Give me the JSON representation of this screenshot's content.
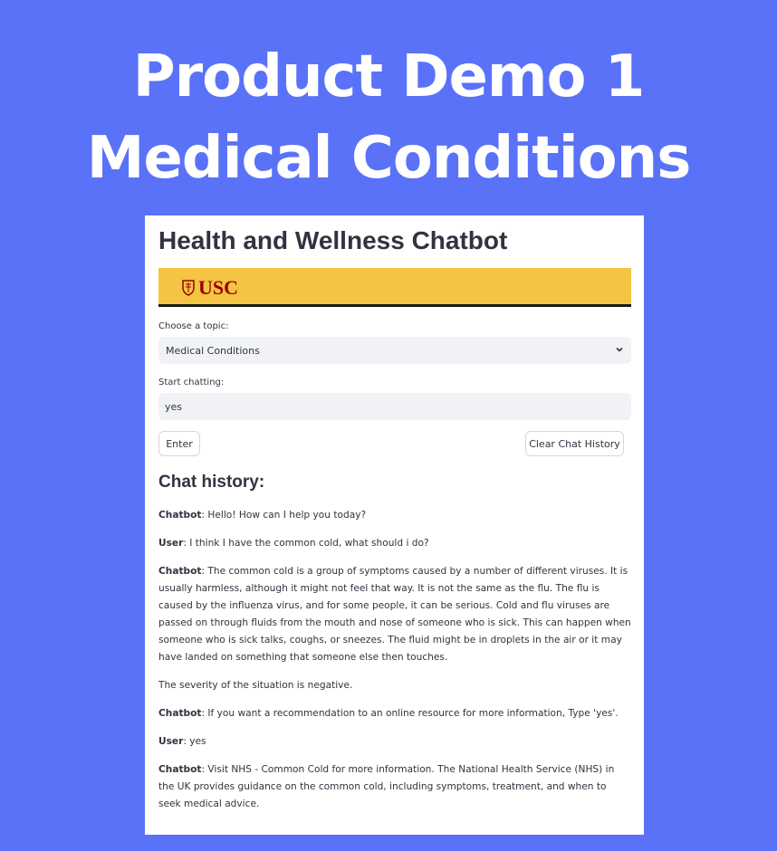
{
  "banner": {
    "line1": "Product Demo 1",
    "line2": "Medical Conditions"
  },
  "app": {
    "title": "Health and Wellness Chatbot",
    "logo_text": "USC",
    "logo_icon": "usc-shield-icon"
  },
  "topic": {
    "label": "Choose a topic:",
    "selected": "Medical Conditions",
    "icon": "chevron-down-icon"
  },
  "chat_input": {
    "label": "Start chatting:",
    "value": "yes"
  },
  "buttons": {
    "enter": "Enter",
    "clear": "Clear Chat History"
  },
  "history": {
    "title": "Chat history:",
    "messages": [
      {
        "speaker": "Chatbot",
        "text": ": Hello! How can I help you today?"
      },
      {
        "speaker": "User",
        "text": ": I think I have the common cold, what should i do?"
      },
      {
        "speaker": "Chatbot",
        "text": ": The common cold is a group of symptoms caused by a number of different viruses. It is usually harmless, although it might not feel that way. It is not the same as the flu. The flu is caused by the influenza virus, and for some people, it can be serious. Cold and flu viruses are passed on through fluids from the mouth and nose of someone who is sick. This can happen when someone who is sick talks, coughs, or sneezes. The fluid might be in droplets in the air or it may have landed on something that someone else then touches."
      },
      {
        "speaker": "",
        "text": "The severity of the situation is negative."
      },
      {
        "speaker": "Chatbot",
        "text": ": If you want a recommendation to an online resource for more information, Type 'yes'."
      },
      {
        "speaker": "User",
        "text": ": yes"
      },
      {
        "speaker": "Chatbot",
        "text": ": Visit NHS - Common Cold for more information. The National Health Service (NHS) in the UK provides guidance on the common cold, including symptoms, treatment, and when to seek medical advice."
      }
    ]
  },
  "colors": {
    "background": "#5a72f7",
    "logo_bar": "#f4c542",
    "usc_cardinal": "#990000"
  }
}
